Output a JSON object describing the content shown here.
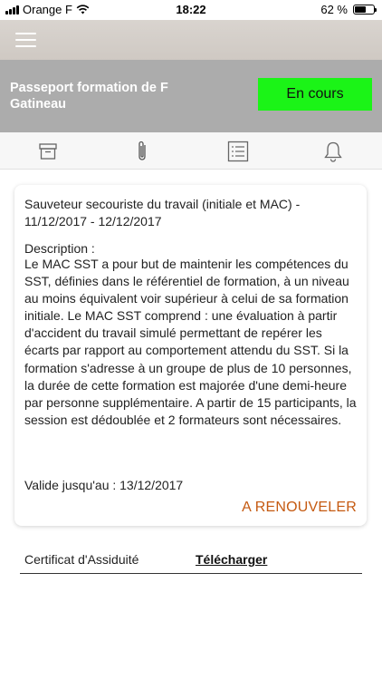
{
  "status_bar": {
    "carrier": "Orange F",
    "time": "18:22",
    "battery_percent_label": "62 %",
    "battery_level": 0.62
  },
  "header": {
    "title": "Passeport formation de F Gatineau",
    "status_label": "En cours",
    "status_color": "#1bf417"
  },
  "tabs": [
    {
      "icon": "archive-icon"
    },
    {
      "icon": "paperclip-icon"
    },
    {
      "icon": "list-icon"
    },
    {
      "icon": "bell-icon"
    }
  ],
  "card": {
    "title": "Sauveteur secouriste du travail (initiale et MAC) - 11/12/2017 - 12/12/2017",
    "description_label": "Description :",
    "description": "Le MAC SST a pour but de maintenir les compétences du SST, définies dans le référentiel de formation, à un niveau au moins équivalent voir supérieur à celui de sa formation initiale. Le MAC SST comprend : une évaluation à partir d'accident du travail simulé permettant de repérer les écarts par rapport au comportement attendu du SST. Si la formation s'adresse à un groupe de plus de 10 personnes, la durée de cette formation est majorée d'une demi-heure par personne supplémentaire. A partir de 15 participants, la session est dédoublée et 2 formateurs sont nécessaires.",
    "valid_until": "Valide jusqu'au : 13/12/2017",
    "renew_label": "A RENOUVELER",
    "renew_color": "#c55a11"
  },
  "certificate": {
    "label": "Certificat d'Assiduité",
    "download_label": "Télécharger"
  }
}
